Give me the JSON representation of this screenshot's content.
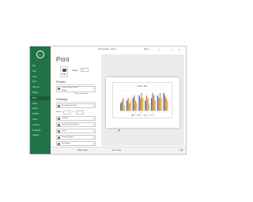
{
  "window": {
    "title": "Presentation - Excel",
    "user": "Sign in",
    "controls": [
      "?",
      "–",
      "□",
      "✕"
    ]
  },
  "sidebar": {
    "back_icon": "back-arrow-icon",
    "items": [
      {
        "label": "Info",
        "active": false
      },
      {
        "label": "New",
        "active": false
      },
      {
        "label": "Open",
        "active": false
      },
      {
        "label": "Save",
        "active": false
      },
      {
        "label": "Save As",
        "active": false
      },
      {
        "label": "History",
        "active": false
      },
      {
        "label": "Print",
        "active": true
      },
      {
        "label": "Share",
        "active": false
      },
      {
        "label": "Export",
        "active": false
      },
      {
        "label": "Publish",
        "active": false
      },
      {
        "label": "Close",
        "active": false
      },
      {
        "label": "Account",
        "active": false
      },
      {
        "label": "Feedback",
        "active": false
      },
      {
        "label": "Options",
        "active": false
      }
    ]
  },
  "print_panel": {
    "title": "Print",
    "print_button_label": "Print",
    "copies_label": "Copies:",
    "copies_value": "1",
    "printer_section": "Printer",
    "printer_name": "Canon MX490 series",
    "printer_status": "Ready",
    "printer_properties_link": "Printer Properties",
    "settings_section": "Settings",
    "settings": [
      "Print Selected Chart",
      "Pages:",
      "Collated",
      "Landscape Orientation",
      "Letter",
      "Normal Margins",
      "No Scaling"
    ],
    "pages_to_label": "to",
    "page_setup_link": "Page Setup"
  },
  "preview": {
    "page_current": "1",
    "page_total": "of 1",
    "zoom_icons": [
      "fit-page-icon",
      "zoom-page-icon"
    ]
  },
  "chart_data": {
    "type": "bar",
    "title": "Chart Title",
    "categories": [
      "1",
      "2",
      "3",
      "4",
      "5",
      "6",
      "7",
      "8"
    ],
    "series": [
      {
        "values": [
          3,
          4,
          5,
          6,
          4,
          5,
          6,
          7
        ]
      },
      {
        "values": [
          4,
          5,
          6,
          5,
          6,
          7,
          5,
          6
        ]
      },
      {
        "values": [
          5,
          3,
          4,
          7,
          5,
          6,
          7,
          5
        ]
      },
      {
        "values": [
          2,
          4,
          3,
          5,
          3,
          4,
          5,
          4
        ]
      }
    ],
    "colors": [
      "#4472c4",
      "#ed7d31",
      "#a5a5a5",
      "#ffc000"
    ],
    "ylim": [
      0,
      8
    ]
  }
}
